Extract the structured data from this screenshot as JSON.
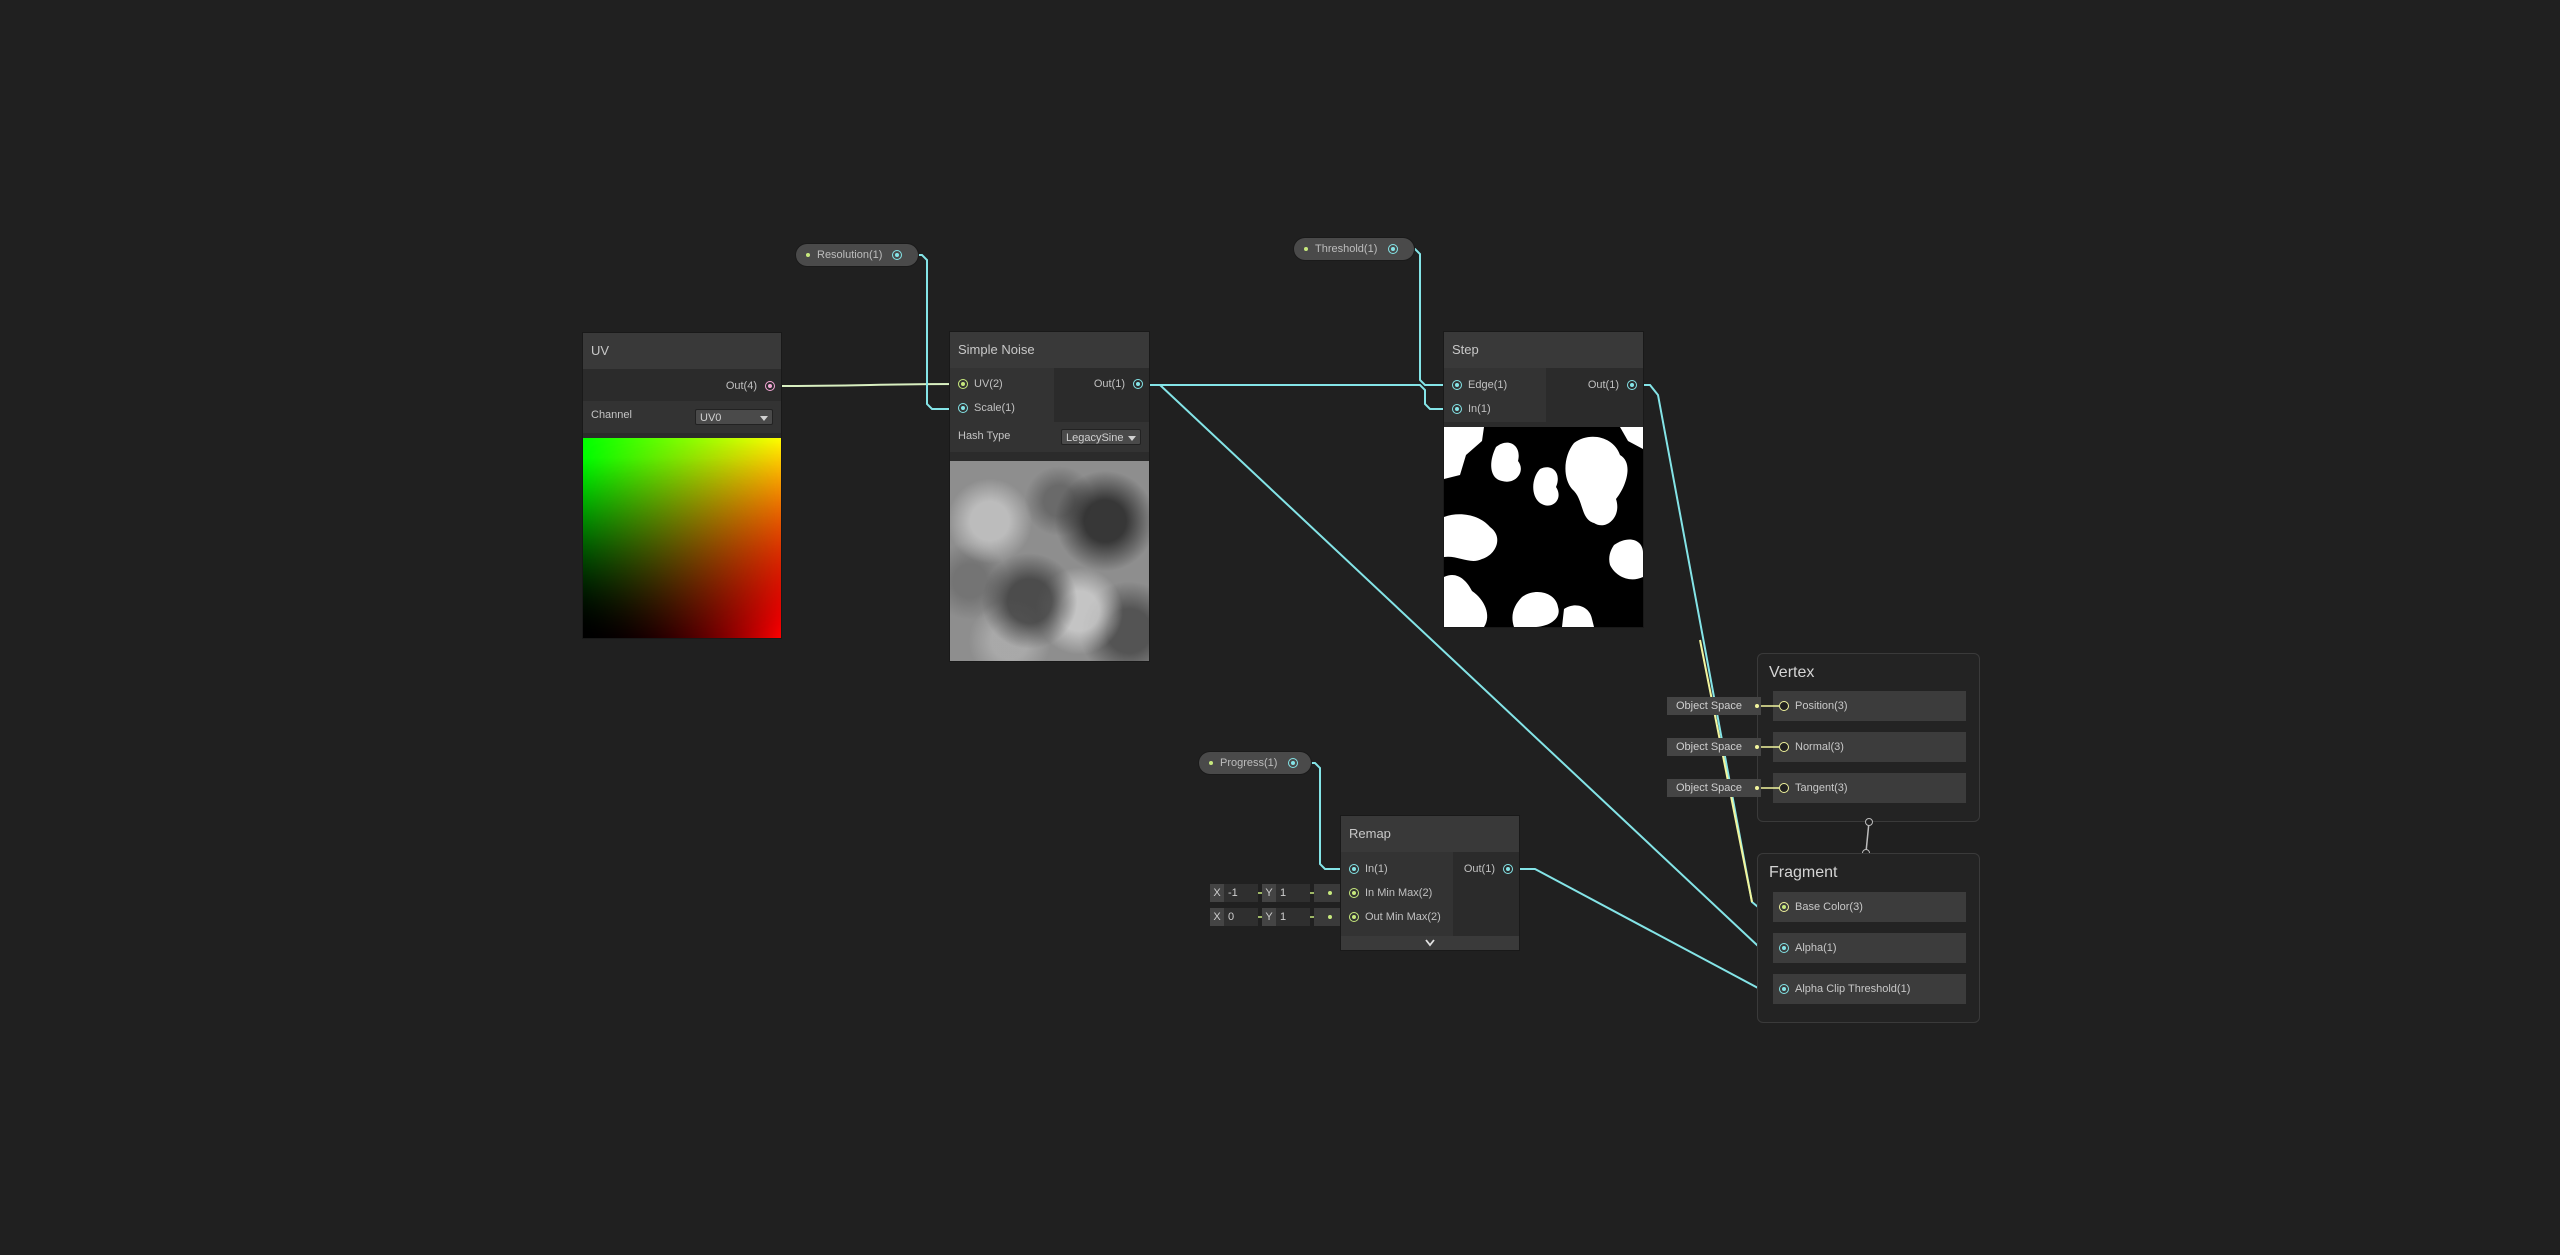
{
  "properties": {
    "resolution": "Resolution(1)",
    "threshold": "Threshold(1)",
    "progress": "Progress(1)"
  },
  "uv_node": {
    "title": "UV",
    "out": "Out(4)",
    "channel_label": "Channel",
    "channel_value": "UV0"
  },
  "noise_node": {
    "title": "Simple Noise",
    "in_uv": "UV(2)",
    "in_scale": "Scale(1)",
    "out": "Out(1)",
    "hash_label": "Hash Type",
    "hash_value": "LegacySine"
  },
  "step_node": {
    "title": "Step",
    "in_edge": "Edge(1)",
    "in_in": "In(1)",
    "out": "Out(1)"
  },
  "remap_node": {
    "title": "Remap",
    "in_in": "In(1)",
    "in_minmax": "In Min Max(2)",
    "out_minmax": "Out Min Max(2)",
    "out": "Out(1)",
    "in_minmax_x": "-1",
    "in_minmax_y": "1",
    "out_minmax_x": "0",
    "out_minmax_y": "1",
    "x_label": "X",
    "y_label": "Y"
  },
  "vertex": {
    "title": "Vertex",
    "slots": [
      "Position(3)",
      "Normal(3)",
      "Tangent(3)"
    ],
    "space": "Object Space"
  },
  "fragment": {
    "title": "Fragment",
    "slots": [
      "Base Color(3)",
      "Alpha(1)",
      "Alpha Clip Threshold(1)"
    ]
  },
  "colors": {
    "background": "#202020",
    "wire_float": "#84e4e7",
    "wire_vector2": "#c7e97d",
    "wire_vector3": "#f2f59e",
    "wire_vector4": "#f4a7d6"
  }
}
